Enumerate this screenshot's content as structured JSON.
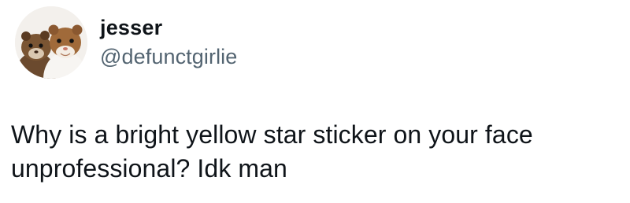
{
  "author": {
    "display_name": "jesser",
    "handle": "@defunctgirlie",
    "avatar_icon": "ferrets-avatar-icon"
  },
  "tweet": {
    "text": "Why is a bright yellow star sticker on your face unprofessional? Idk man"
  },
  "colors": {
    "text_primary": "#0f1419",
    "text_secondary": "#536471",
    "background": "#ffffff"
  }
}
